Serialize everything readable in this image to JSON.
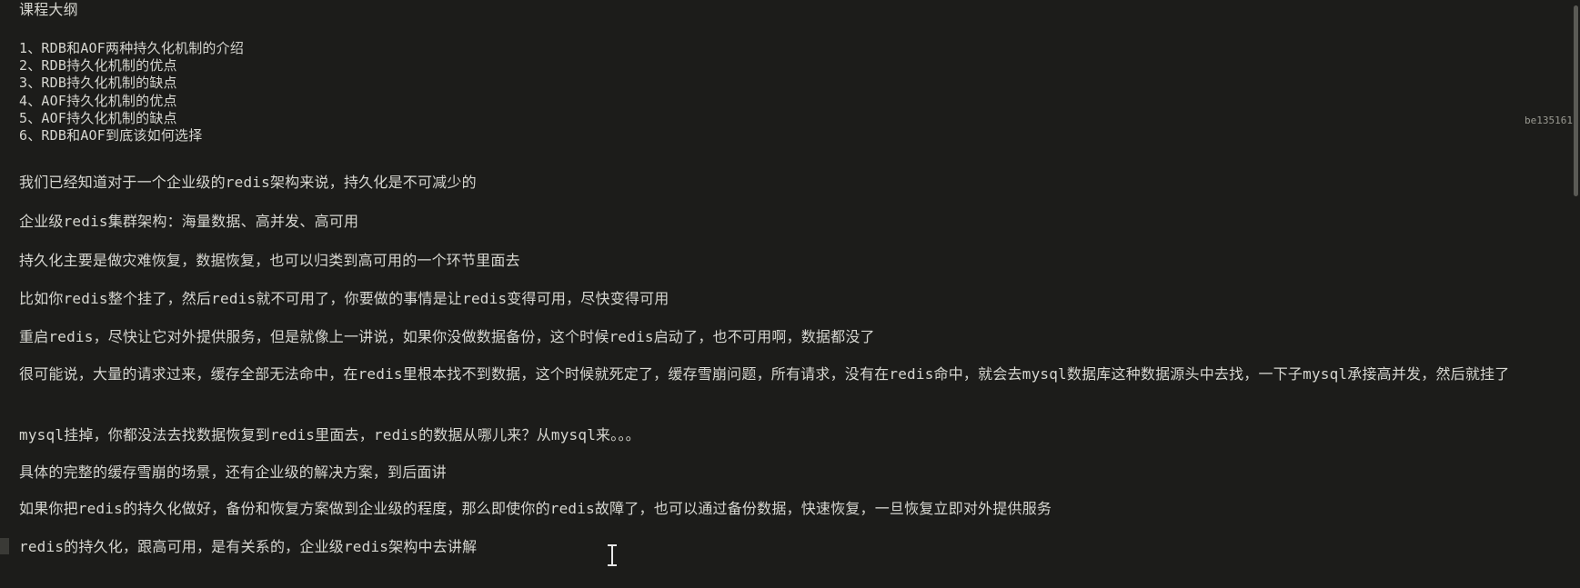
{
  "document": {
    "title": "课程大纲",
    "outline": [
      "1、RDB和AOF两种持久化机制的介绍",
      "2、RDB持久化机制的优点",
      "3、RDB持久化机制的缺点",
      "4、AOF持久化机制的优点",
      "5、AOF持久化机制的缺点",
      "6、RDB和AOF到底该如何选择"
    ],
    "paragraphs": [
      "我们已经知道对于一个企业级的redis架构来说，持久化是不可减少的",
      "企业级redis集群架构：海量数据、高并发、高可用",
      "持久化主要是做灾难恢复，数据恢复，也可以归类到高可用的一个环节里面去",
      "比如你redis整个挂了，然后redis就不可用了，你要做的事情是让redis变得可用，尽快变得可用",
      "重启redis，尽快让它对外提供服务，但是就像上一讲说，如果你没做数据备份，这个时候redis启动了，也不可用啊，数据都没了",
      "很可能说，大量的请求过来，缓存全部无法命中，在redis里根本找不到数据，这个时候就死定了，缓存雪崩问题，所有请求，没有在redis命中，就会去mysql数据库这种数据源头中去找，一下子mysql承接高并发，然后就挂了",
      "mysql挂掉，你都没法去找数据恢复到redis里面去，redis的数据从哪儿来？从mysql来。。。",
      "具体的完整的缓存雪崩的场景，还有企业级的解决方案，到后面讲",
      "如果你把redis的持久化做好，备份和恢复方案做到企业级的程度，那么即使你的redis故障了，也可以通过备份数据，快速恢复，一旦恢复立即对外提供服务",
      "redis的持久化，跟高可用，是有关系的，企业级redis架构中去讲解"
    ],
    "divider": "--------------------------------------------------------------------------------------------------------",
    "right_edge_fragment": "be135161"
  }
}
